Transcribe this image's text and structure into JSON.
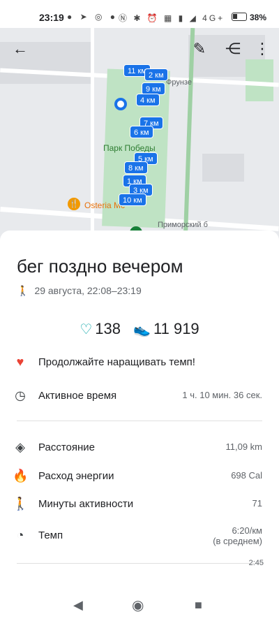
{
  "status_bar": {
    "time": "23:19",
    "battery": "38%",
    "network": "4G+"
  },
  "map": {
    "street_top": "Фрунзе",
    "street_bottom": "Приморский б",
    "park_name": "Парк Победы",
    "poi_name": "Osteria Mc",
    "km_markers": [
      "11 км",
      "2 км",
      "9 км",
      "4 км",
      "7 км",
      "6 км",
      "5 км",
      "8 км",
      "1 км",
      "3 км",
      "10 км"
    ]
  },
  "activity": {
    "title": "бег поздно вечером",
    "subtitle": "29 августа, 22:08–23:19",
    "heart_points": "138",
    "steps": "11 919",
    "tip": "Продолжайте наращивать темп!",
    "active_time_label": "Активное время",
    "active_time_value": "1 ч. 10 мин. 36 сек.",
    "distance_label": "Расстояние",
    "distance_value": "11,09 km",
    "energy_label": "Расход энергии",
    "energy_value": "698 Cal",
    "move_minutes_label": "Минуты активности",
    "move_minutes_value": "71",
    "pace_label": "Темп",
    "pace_value": "6:20/км",
    "pace_note": "(в среднем)",
    "chart_tick": "2:45"
  },
  "icons": [
    "back-arrow-icon",
    "edit-pencil-icon",
    "share-icon",
    "more-vert-icon",
    "walker-icon",
    "heart-icon",
    "shoe-icon",
    "fit-logo-icon",
    "timer-icon",
    "location-icon",
    "flame-icon",
    "walking-icon",
    "speedometer-icon"
  ]
}
